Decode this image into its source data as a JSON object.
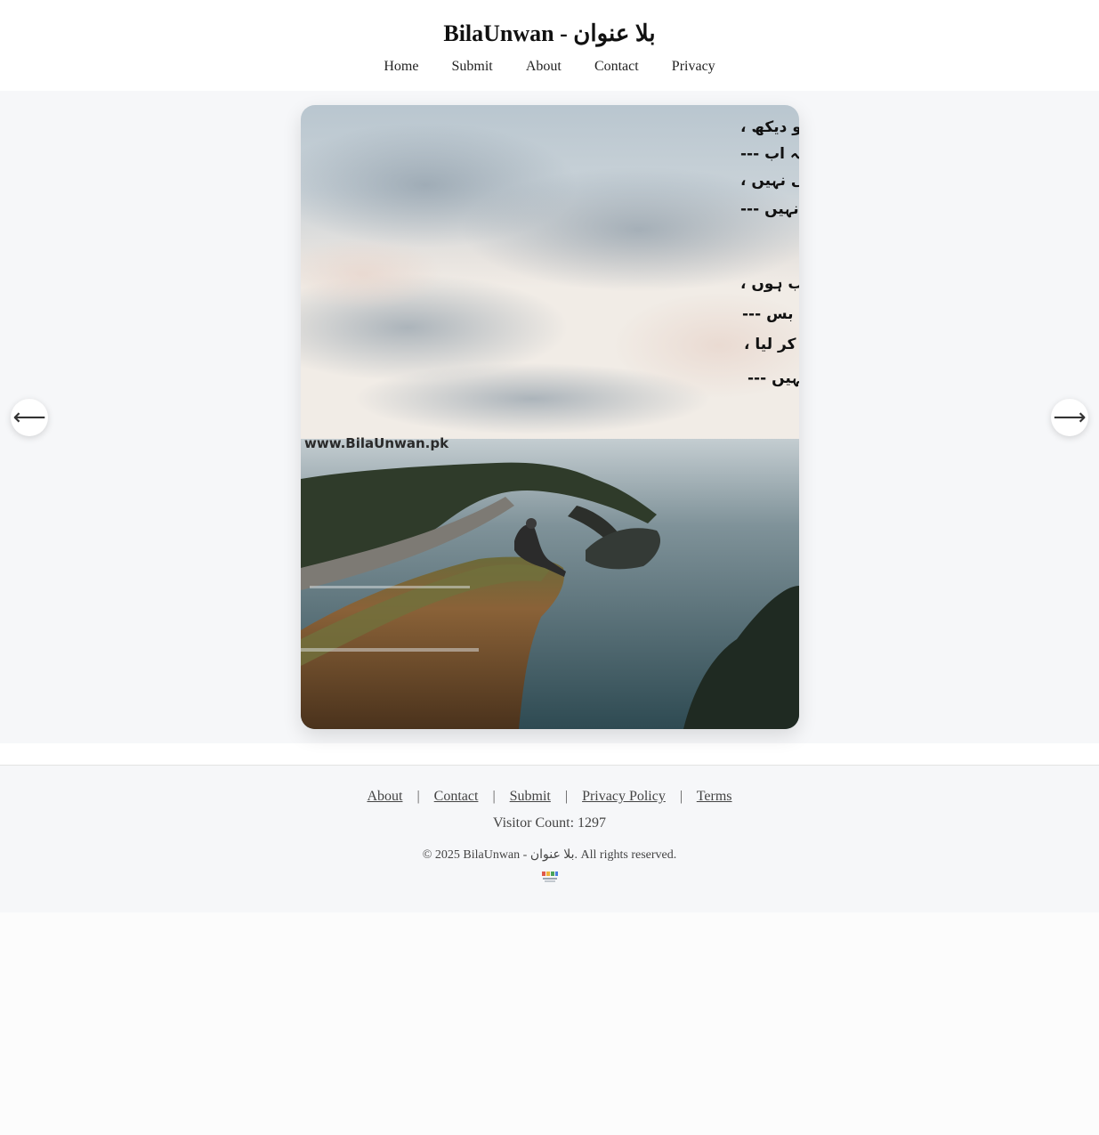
{
  "site": {
    "title": "BilaUnwan - بلا عنوان"
  },
  "nav": {
    "items": [
      "Home",
      "Submit",
      "About",
      "Contact",
      "Privacy"
    ]
  },
  "slider": {
    "prev_label": "⟵",
    "next_label": "⟶",
    "image": {
      "watermark": "www.BilaUnwan.pk",
      "poem_lines": [
        "تو میرا حوصلہ تو دیکھ ،",
        "داد تو دے مجھے کہ اب ---",
        "شوق کمال بھی نہیں ،",
        "خوف کمال بھی نہیں ---",
        "میں بھی بہت عجیب ہوں ،",
        "اِتنا عجیب ہوں کہ بس ---",
        "خود کو تباہ کر لیا ،",
        "اور ملال بھی نہیں ---"
      ]
    }
  },
  "footer": {
    "links": [
      "About",
      "Contact",
      "Submit",
      "Privacy Policy",
      "Terms"
    ],
    "separator": "|",
    "visitor_count": "Visitor Count: 1297",
    "copyright": "© 2025 BilaUnwan - بلا عنوان. All rights reserved."
  },
  "colors": {
    "header_bg": "#ffffff",
    "stage_bg": "#f6f7f9",
    "page_bg": "#fcfcfc"
  }
}
